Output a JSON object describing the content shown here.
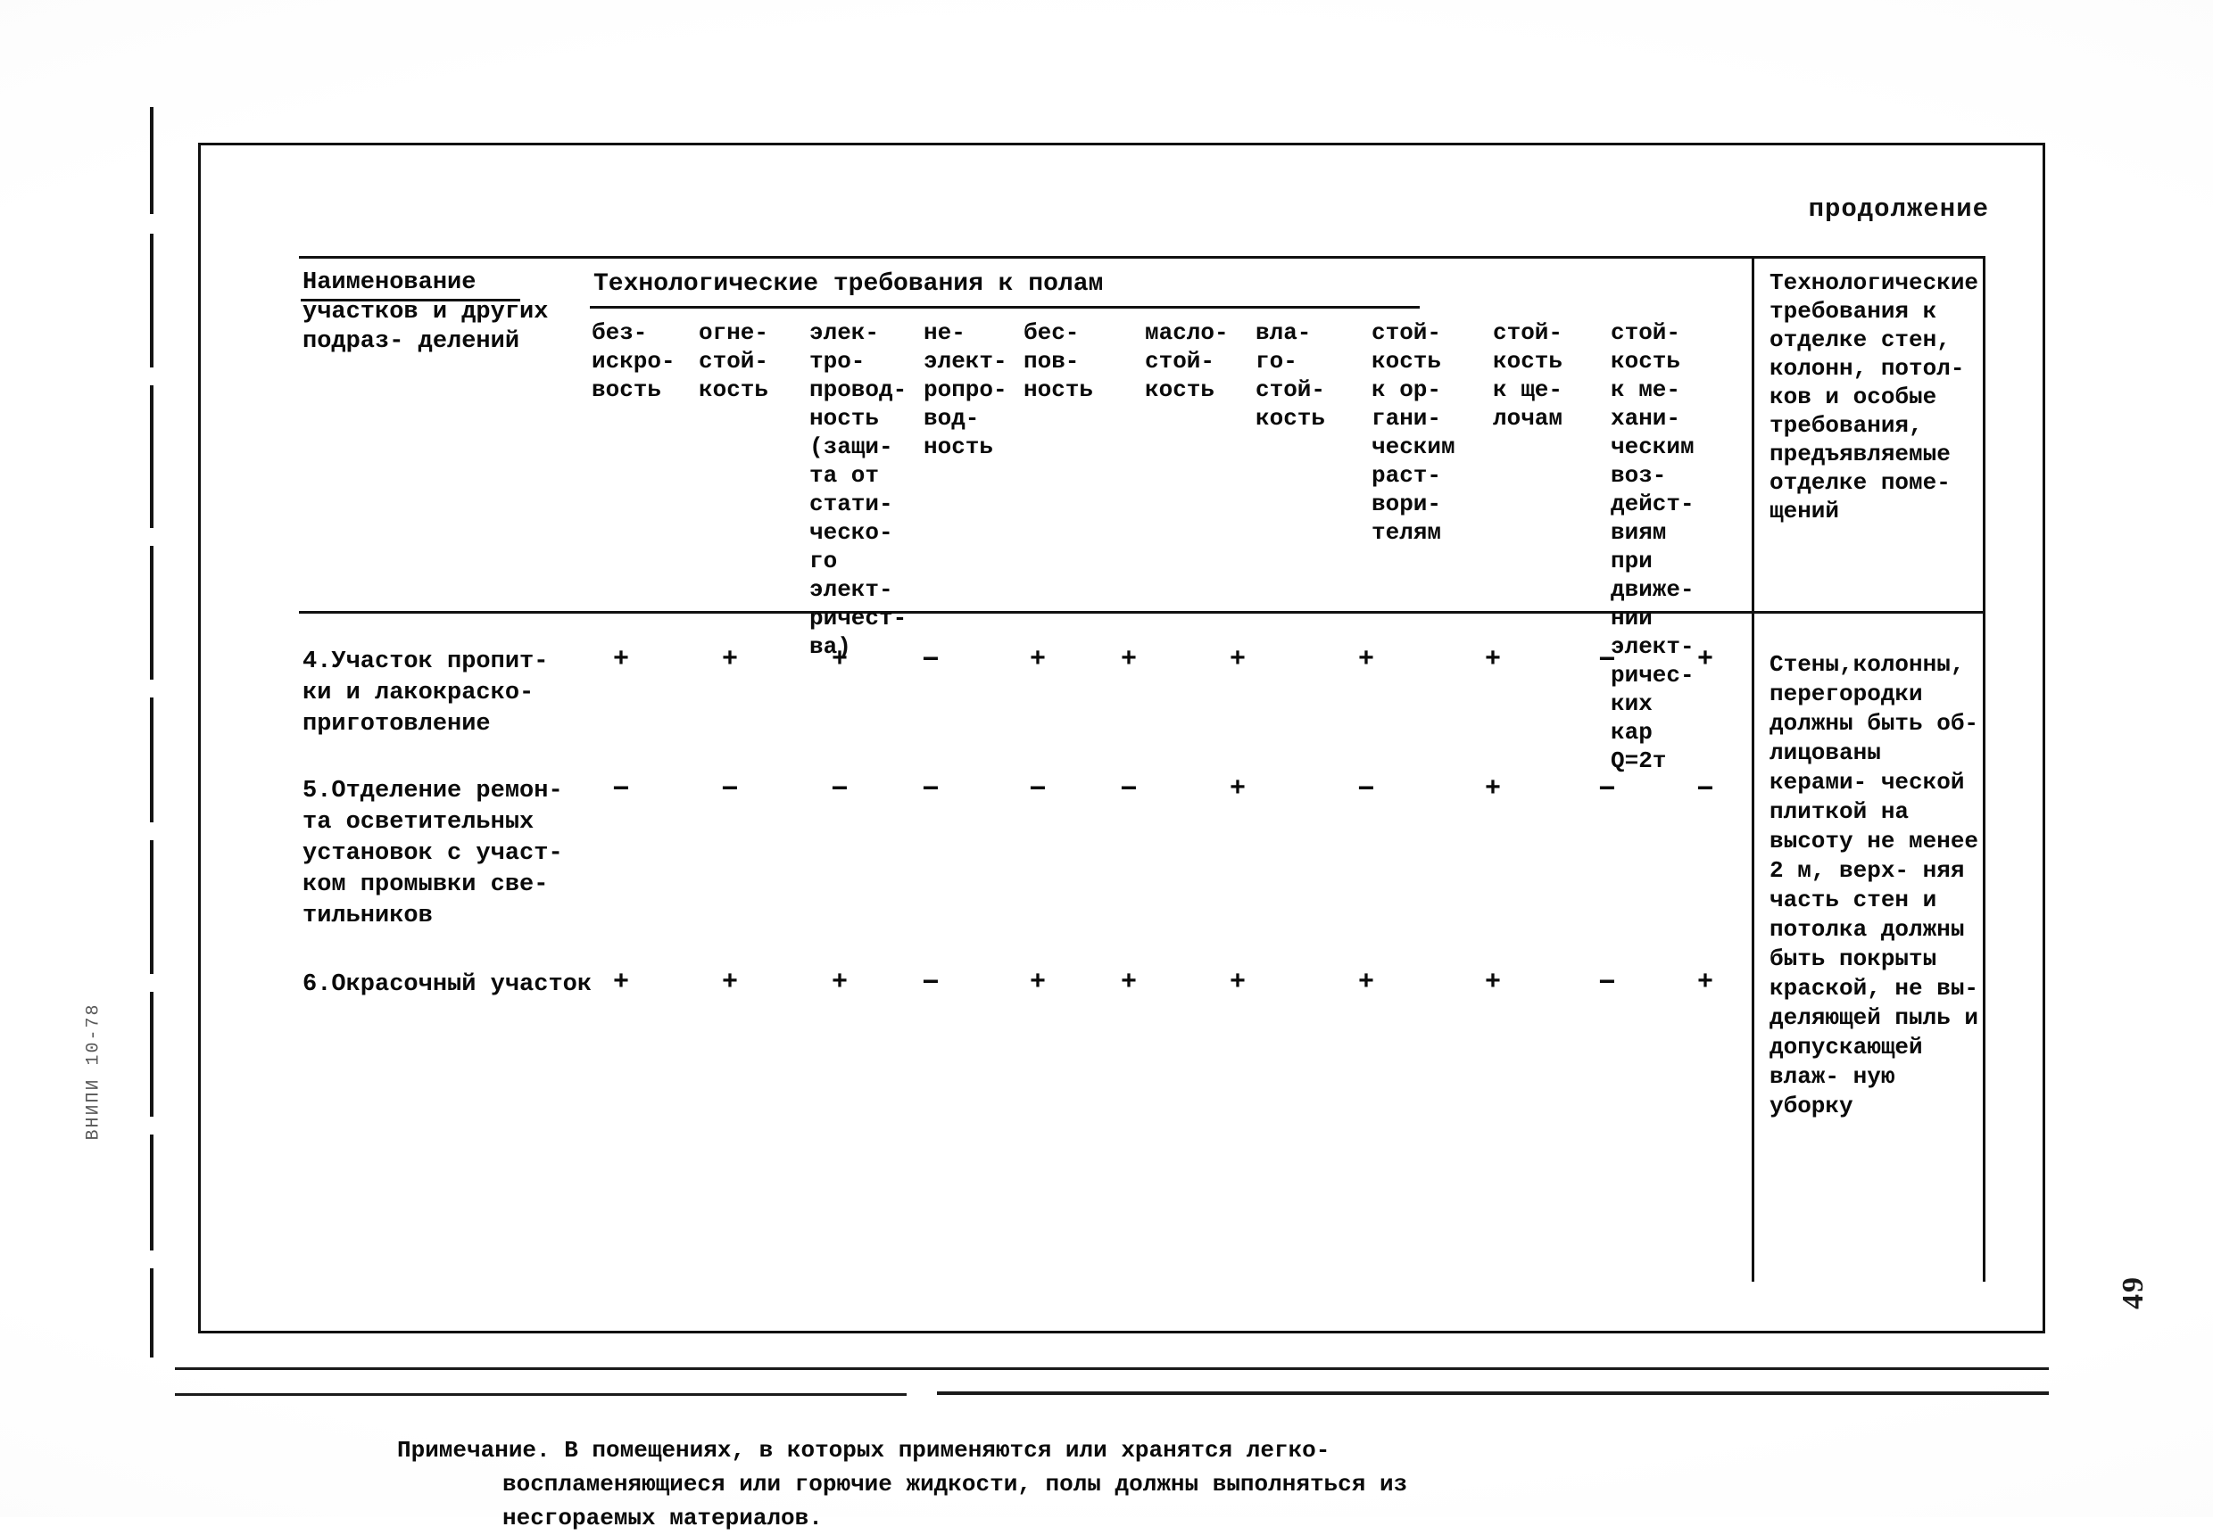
{
  "document": {
    "continuation_label": "продолжение",
    "page_number": "49",
    "archive_code": "ВНИПИ 10-78"
  },
  "table": {
    "stub_header": "Наименование\nучастков и\nдругих подраз-\nделений",
    "group_header": "Технологические требования к полам",
    "right_header": "Технологические\nтребования к\nотделке стен,\nколонн, потол-\nков и особые\nтребования,\nпредъявляемые\nотделке поме-\nщений",
    "column_headers": [
      "без-\nискро-\nвость",
      "огне-\nстой-\nкость",
      "элек-\nтро-\nпровод-\nность\n(защи-\nта от\nстати-\nческо-\nго\nэлект-\nричест-\nва)",
      "не-\nэлект-\nропро-\nвод-\nность",
      "бес-\nпов-\nность",
      "масло-\nстой-\nкость",
      "вла-\nго-\nстой-\nкость",
      "стой-\nкость\nк ор-\nгани-\nческим\nраст-\nвори-\nтелям",
      "стой-\nкость\nк ще-\nлочам",
      "стой-\nкость\nк ме-\nхани-\nческим\nвоз-\nдейст-\nвиям\nпри\nдвиже-\nнии\nэлект-\nричес-\nких\nкар\nQ=2т"
    ],
    "rows": [
      {
        "label": "4.Участок пропит-\n  ки и лакокраско-\n  приготовление",
        "marks": [
          "+",
          "+",
          "+",
          "−",
          "+",
          "+",
          "+",
          "+",
          "+",
          "−",
          "+"
        ]
      },
      {
        "label": "5.Отделение ремон-\n  та осветительных\n  установок с участ-\n  ком промывки све-\n  тильников",
        "marks": [
          "−",
          "−",
          "−",
          "−",
          "−",
          "−",
          "+",
          "−",
          "+",
          "−",
          "−"
        ]
      },
      {
        "label": "6.Окрасочный участок",
        "marks": [
          "+",
          "+",
          "+",
          "−",
          "+",
          "+",
          "+",
          "+",
          "+",
          "−",
          "+"
        ]
      }
    ],
    "right_body": "Стены,колонны,\nперегородки\nдолжны быть об-\nлицованы керами-\nческой плиткой\nна высоту не\nменее 2 м, верх-\nняя часть стен\nи потолка должны\nбыть покрыты\nкраской, не вы-\nделяющей пыль и\nдопускающей влаж-\nную уборку"
  },
  "footnote": {
    "lead": "Примечание. В помещениях, в которых  применяются или хранятся легко-",
    "line2": "воспламеняющиеся или горючие жидкости, полы должны выполняться из",
    "line3": "несгораемых материалов."
  }
}
